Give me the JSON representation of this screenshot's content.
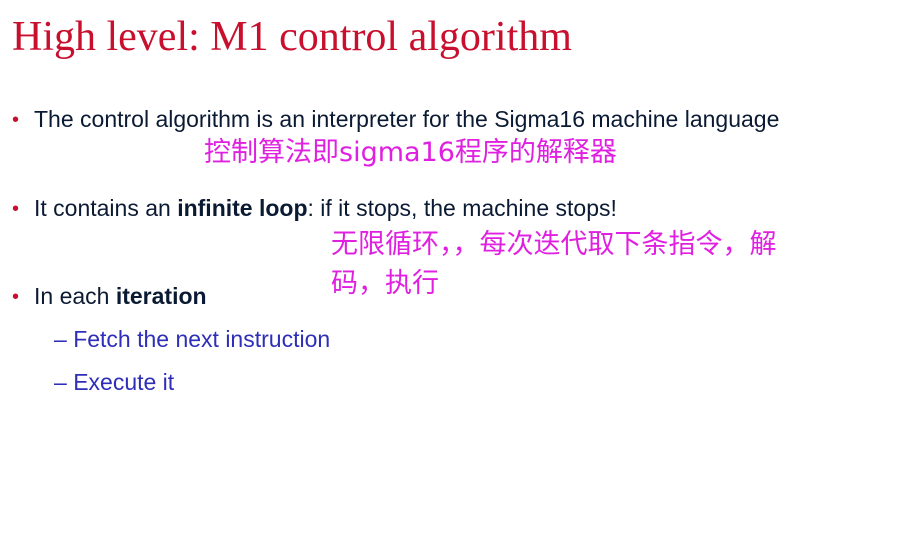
{
  "slide": {
    "title": "High level: M1 control algorithm",
    "bullets": [
      {
        "prefix": "The control algorithm is an interpreter for the Sigma16 machine language",
        "bold": "",
        "suffix": ""
      },
      {
        "prefix": "It contains an ",
        "bold": "infinite loop",
        "suffix": ": if it stops, the machine stops!"
      },
      {
        "prefix": "In each ",
        "bold": "iteration",
        "suffix": ""
      }
    ],
    "sub_items": [
      "Fetch the next instruction",
      "Execute it"
    ],
    "annotations": [
      "控制算法即sigma16程序的解释器",
      "无限循环，，每次迭代取下条指令，解",
      "码，执行"
    ],
    "colors": {
      "title": "#c8102e",
      "bullet_marker": "#c8102e",
      "body_text": "#0b1a33",
      "sub_text": "#2e2eb8",
      "annotation": "#e020e0"
    }
  }
}
